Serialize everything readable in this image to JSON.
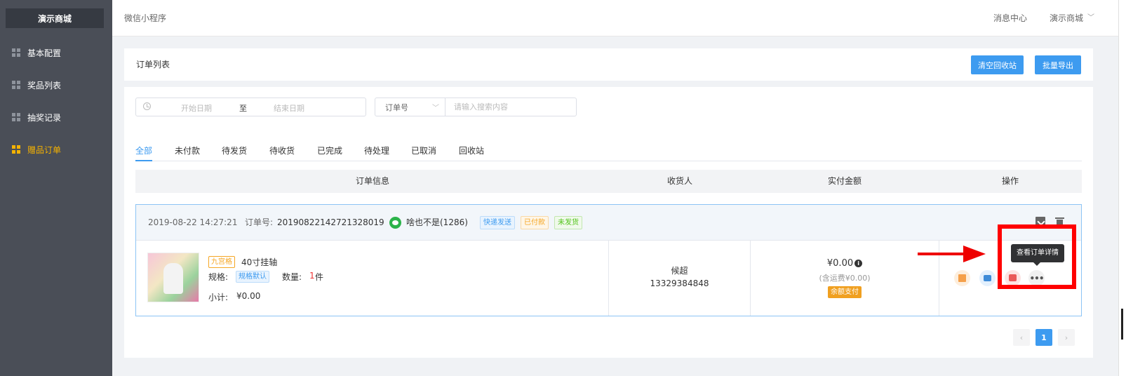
{
  "sidebar": {
    "brand": "演示商城",
    "items": [
      {
        "label": "基本配置"
      },
      {
        "label": "奖品列表"
      },
      {
        "label": "抽奖记录"
      },
      {
        "label": "赠品订单",
        "active": true
      }
    ]
  },
  "topbar": {
    "breadcrumb": "微信小程序",
    "message_center": "消息中心",
    "shop_name": "演示商城"
  },
  "header": {
    "title": "订单列表",
    "clear_recycle": "清空回收站",
    "batch_export": "批量导出"
  },
  "filters": {
    "start_placeholder": "开始日期",
    "separator": "至",
    "end_placeholder": "结束日期",
    "search_field": "订单号",
    "search_placeholder": "请输入搜索内容"
  },
  "tabs": [
    "全部",
    "未付款",
    "待发货",
    "待收货",
    "已完成",
    "待处理",
    "已取消",
    "回收站"
  ],
  "columns": {
    "order_info": "订单信息",
    "receiver": "收货人",
    "paid_amount": "实付金额",
    "actions": "操作"
  },
  "order": {
    "time": "2019-08-22 14:27:21",
    "order_no_label": "订单号:",
    "order_no": "20190822142721328019",
    "buyer": "啥也不是(1286)",
    "tags": [
      "快递发送",
      "已付款",
      "未发货"
    ],
    "product": {
      "badge": "九宫格",
      "name": "40寸挂轴",
      "spec_label": "规格:",
      "spec_value": "规格默认",
      "qty_label": "数量:",
      "qty_value": "1",
      "qty_unit": "件",
      "subtotal_label": "小计:",
      "subtotal": "¥0.00"
    },
    "receiver_name": "候超",
    "receiver_phone": "13329384848",
    "amount": "¥0.00",
    "shipping": "(含运费¥0.00)",
    "pay_method": "余额支付",
    "tooltip": "查看订单详情",
    "more": "•••"
  },
  "pagination": {
    "prev": "‹",
    "current": "1",
    "next": "›"
  },
  "colors": {
    "primary": "#3d9bf0",
    "sidebar_bg": "#4a4e57",
    "active": "#f5b200",
    "annotation": "#ff0000"
  }
}
